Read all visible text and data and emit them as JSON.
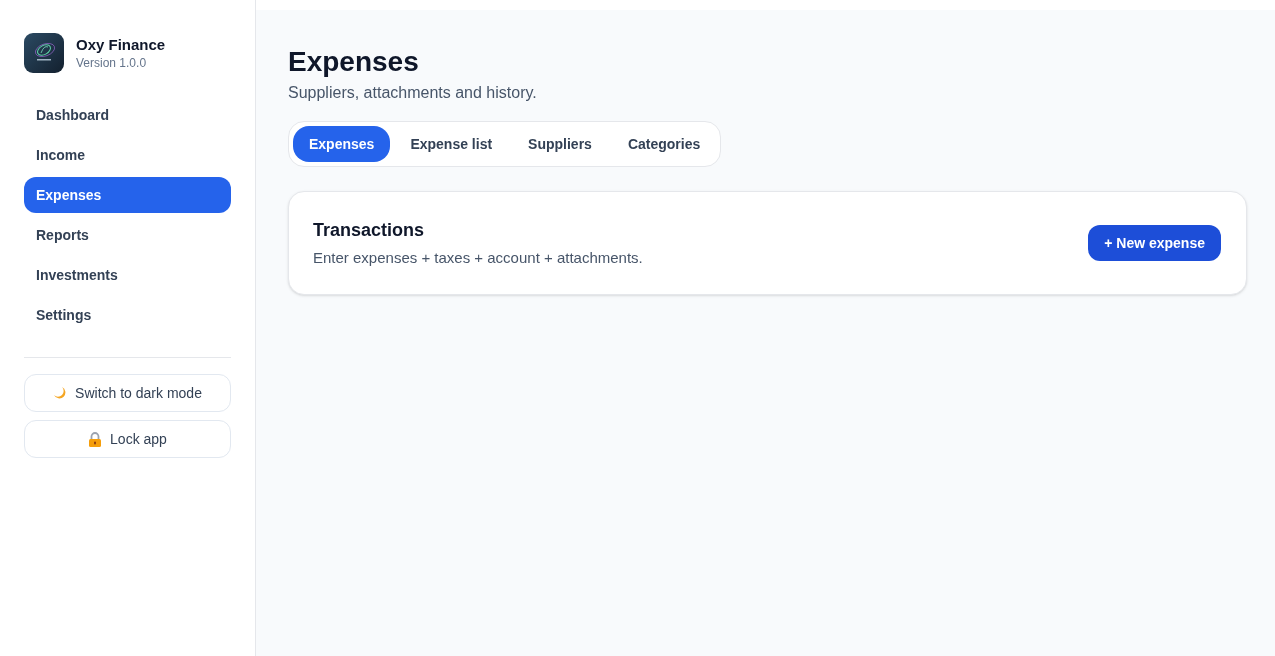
{
  "app": {
    "name": "Oxy Finance",
    "version": "Version 1.0.0"
  },
  "nav": [
    {
      "label": "Dashboard",
      "selected": false
    },
    {
      "label": "Income",
      "selected": false
    },
    {
      "label": "Expenses",
      "selected": true
    },
    {
      "label": "Reports",
      "selected": false
    },
    {
      "label": "Investments",
      "selected": false
    },
    {
      "label": "Settings",
      "selected": false
    }
  ],
  "sidebar_buttons": [
    {
      "kind": "theme",
      "label": "Switch to dark mode"
    },
    {
      "kind": "lock",
      "label": "Lock app"
    }
  ],
  "page": {
    "title": "Expenses",
    "subtitle": "Suppliers, attachments and history."
  },
  "tabs": [
    {
      "label": "Expenses",
      "selected": true
    },
    {
      "label": "Expense list",
      "selected": false
    },
    {
      "label": "Suppliers",
      "selected": false
    },
    {
      "label": "Categories",
      "selected": false
    }
  ],
  "card": {
    "title": "Transactions",
    "description": "Enter expenses + taxes + account + attachments.",
    "button": "+ New expense"
  }
}
